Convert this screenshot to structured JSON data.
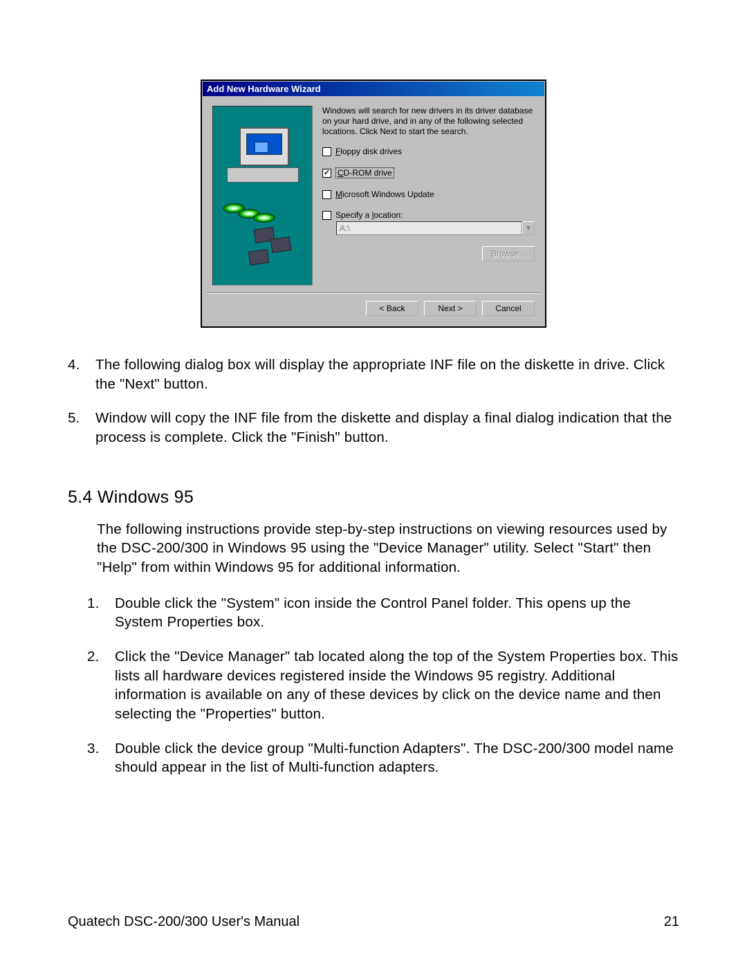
{
  "dialog": {
    "title": "Add New Hardware Wizard",
    "intro": "Windows will search for new drivers in its driver database on your hard drive, and in any of the following selected locations. Click Next to start the search.",
    "checkboxes": {
      "floppy": "Floppy disk drives",
      "cdrom": "CD-ROM drive",
      "winupdate": "Microsoft Windows Update",
      "specify": "Specify a location:"
    },
    "location_value": "A:\\",
    "buttons": {
      "browse": "Browse...",
      "back": "< Back",
      "next": "Next >",
      "cancel": "Cancel"
    }
  },
  "steps_top": [
    {
      "n": "4.",
      "t": "The following dialog box will display the appropriate INF file on the diskette in drive. Click the \"Next\" button."
    },
    {
      "n": "5.",
      "t": "Window will copy the INF file from the diskette and display a final dialog indication that the process is complete. Click the \"Finish\" button."
    }
  ],
  "section": {
    "heading": "5.4  Windows 95",
    "intro": "The following instructions provide step-by-step instructions on viewing resources used by the DSC-200/300 in Windows 95 using the \"Device Manager\" utility.  Select \"Start\" then \"Help\" from within Windows 95 for additional information."
  },
  "steps_sub": [
    {
      "n": "1.",
      "t": "Double click the \"System\" icon inside the Control Panel folder.  This opens up the System Properties box."
    },
    {
      "n": "2.",
      "t": "Click the \"Device Manager\" tab located along the top of the System Properties box.  This lists all hardware devices registered inside the Windows 95 registry.  Additional information is available on any of these devices by click on the device name and then selecting the \"Properties\" button."
    },
    {
      "n": "3.",
      "t": "Double click the device group \"Multi-function Adapters\".  The DSC-200/300 model name should appear in the list of Multi-function adapters."
    }
  ],
  "footer": {
    "left": "Quatech   DSC-200/300 User's Manual",
    "right": "21"
  }
}
